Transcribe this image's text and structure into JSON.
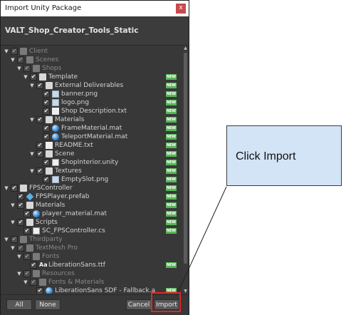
{
  "window": {
    "title": "Import Unity Package",
    "close_glyph": "x"
  },
  "package": {
    "name": "VALT_Shop_Creator_Tools_Static"
  },
  "badge_text": "NEW",
  "tree": [
    {
      "label": "Client",
      "indent": 0,
      "dim": true,
      "folder": true,
      "icon": "folder-icon",
      "badge": false
    },
    {
      "label": "Scenes",
      "indent": 1,
      "dim": true,
      "folder": true,
      "icon": "folder-icon",
      "badge": false
    },
    {
      "label": "Shops",
      "indent": 2,
      "dim": true,
      "folder": true,
      "icon": "folder-icon",
      "badge": false
    },
    {
      "label": "Template",
      "indent": 3,
      "dim": false,
      "folder": true,
      "icon": "folder-icon",
      "badge": true
    },
    {
      "label": "External Deliverables",
      "indent": 4,
      "dim": false,
      "folder": true,
      "icon": "folder-icon",
      "badge": true
    },
    {
      "label": "banner.png",
      "indent": 5,
      "dim": false,
      "folder": false,
      "icon": "image-icon",
      "badge": true
    },
    {
      "label": "logo.png",
      "indent": 5,
      "dim": false,
      "folder": false,
      "icon": "image-icon",
      "badge": true
    },
    {
      "label": "Shop Description.txt",
      "indent": 5,
      "dim": false,
      "folder": false,
      "icon": "text-file-icon",
      "badge": true
    },
    {
      "label": "Materials",
      "indent": 4,
      "dim": false,
      "folder": true,
      "icon": "folder-icon",
      "badge": true
    },
    {
      "label": "FrameMaterial.mat",
      "indent": 5,
      "dim": false,
      "folder": false,
      "icon": "material-icon",
      "badge": true
    },
    {
      "label": "TeleportMaterial.mat",
      "indent": 5,
      "dim": false,
      "folder": false,
      "icon": "material-icon",
      "badge": true
    },
    {
      "label": "README.txt",
      "indent": 4,
      "dim": false,
      "folder": false,
      "icon": "text-file-icon",
      "badge": true
    },
    {
      "label": "Scene",
      "indent": 4,
      "dim": false,
      "folder": true,
      "icon": "folder-icon",
      "badge": true
    },
    {
      "label": "ShopInterior.unity",
      "indent": 5,
      "dim": false,
      "folder": false,
      "icon": "scene-icon",
      "badge": true
    },
    {
      "label": "Textures",
      "indent": 4,
      "dim": false,
      "folder": true,
      "icon": "folder-icon",
      "badge": true
    },
    {
      "label": "EmptySlot.png",
      "indent": 5,
      "dim": false,
      "folder": false,
      "icon": "image-icon",
      "badge": true
    },
    {
      "label": "FPSController",
      "indent": 0,
      "dim": false,
      "folder": true,
      "icon": "folder-icon",
      "badge": true
    },
    {
      "label": "FPSPlayer.prefab",
      "indent": 1,
      "dim": false,
      "folder": false,
      "icon": "prefab-icon",
      "badge": true
    },
    {
      "label": "Materials",
      "indent": 1,
      "dim": false,
      "folder": true,
      "icon": "folder-icon",
      "badge": true
    },
    {
      "label": "player_material.mat",
      "indent": 2,
      "dim": false,
      "folder": false,
      "icon": "material-icon",
      "badge": true
    },
    {
      "label": "Scripts",
      "indent": 1,
      "dim": false,
      "folder": true,
      "icon": "folder-icon",
      "badge": true
    },
    {
      "label": "SC_FPSController.cs",
      "indent": 2,
      "dim": false,
      "folder": false,
      "icon": "script-icon",
      "badge": true
    },
    {
      "label": "Thirdparty",
      "indent": 0,
      "dim": true,
      "folder": true,
      "icon": "folder-icon",
      "badge": false
    },
    {
      "label": "TextMesh Pro",
      "indent": 1,
      "dim": true,
      "folder": true,
      "icon": "folder-icon",
      "badge": false
    },
    {
      "label": "Fonts",
      "indent": 2,
      "dim": true,
      "folder": true,
      "icon": "folder-icon",
      "badge": false
    },
    {
      "label": "LiberationSans.ttf",
      "indent": 3,
      "dim": false,
      "folder": false,
      "icon": "font-icon",
      "badge": true
    },
    {
      "label": "Resources",
      "indent": 2,
      "dim": true,
      "folder": true,
      "icon": "folder-icon",
      "badge": false
    },
    {
      "label": "Fonts & Materials",
      "indent": 3,
      "dim": true,
      "folder": true,
      "icon": "folder-icon",
      "badge": false
    },
    {
      "label": "LiberationSans SDF - Fallback.a",
      "indent": 4,
      "dim": false,
      "folder": false,
      "icon": "font-asset-icon",
      "badge": true
    }
  ],
  "font_icon_glyph": "Aa",
  "checkmark": "✔",
  "expand_glyph": "▼",
  "scroll_up": "▲",
  "scroll_down": "▼",
  "footer": {
    "all": "All",
    "none": "None",
    "cancel": "Cancel",
    "import": "Import"
  },
  "annotation": {
    "text": "Click Import"
  },
  "colors": {
    "badge": "#57b557",
    "highlight": "#e32424",
    "callout_fill": "#d4e4f7"
  }
}
